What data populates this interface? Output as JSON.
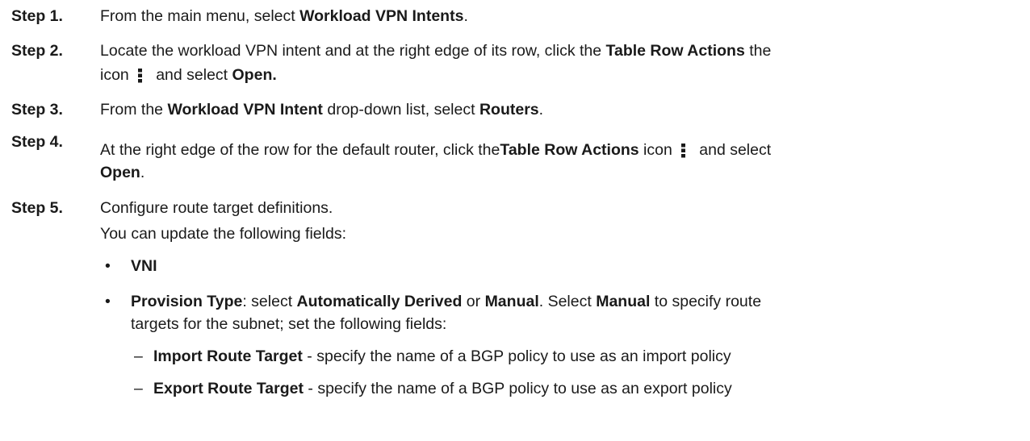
{
  "steps": [
    {
      "label": "Step 1.",
      "t1": "From the main menu, select ",
      "b1": "Workload VPN Intents",
      "t2": "."
    },
    {
      "label": "Step 2.",
      "t1": "Locate the workload VPN intent and at the right edge of its row, click the ",
      "b1": "Table Row Actions",
      "t2": " the",
      "t3": "icon",
      "icon": "kebab-menu-icon",
      "t4": " and select ",
      "b2": "Open."
    },
    {
      "label": "Step 3.",
      "t1": "From the ",
      "b1": "Workload VPN Intent",
      "t2": " drop-down list, select ",
      "b2": "Routers",
      "t3": "."
    },
    {
      "label": "Step 4.",
      "t1": "At the right edge of the row for the default router, click the",
      "b1": "Table Row Actions",
      "t2": " icon",
      "icon": "kebab-menu-icon",
      "t3": " and select",
      "b2": "Open",
      "t4": "."
    },
    {
      "label": "Step 5.",
      "t1": "Configure route target definitions.",
      "t2": "You can update the following fields:",
      "bullets": [
        {
          "b1": "VNI"
        },
        {
          "b1": "Provision Type",
          "t1": ": select ",
          "b2": "Automatically Derived",
          "t2": " or ",
          "b3": "Manual",
          "t3": ". Select ",
          "b4": "Manual",
          "t4": " to specify route",
          "t5": "targets for the subnet; set the following fields:"
        }
      ],
      "subitems": [
        {
          "b1": "Import Route Target",
          "t1": " - specify the name of a BGP policy to use as an import policy"
        },
        {
          "b1": "Export Route Target",
          "t1": " - specify the name of a BGP policy to use as an export policy"
        }
      ]
    }
  ]
}
